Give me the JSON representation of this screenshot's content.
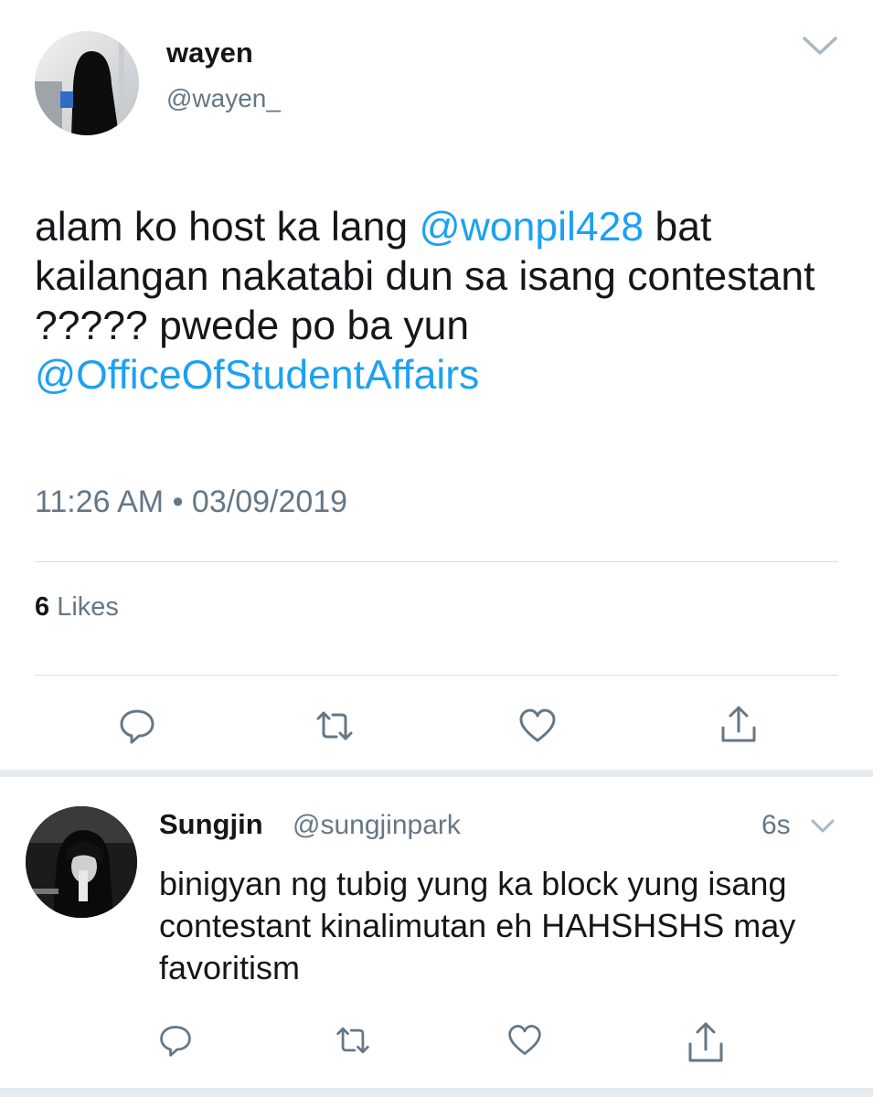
{
  "tweet": {
    "display_name": "wayen",
    "handle": "@wayen_",
    "text_1": "alam ko host ka lang ",
    "mention_1": "@wonpil428",
    "text_2": " bat kailangan nakatabi dun sa isang contestant ????? pwede po ba yun ",
    "mention_2": "@OfficeOfStudentAffairs",
    "timestamp": "11:26 AM • 03/09/2019",
    "likes_count": "6",
    "likes_label": " Likes",
    "actions": [
      "reply-icon",
      "retweet-icon",
      "like-icon",
      "share-icon"
    ]
  },
  "reply": {
    "display_name": "Sungjin",
    "handle": "@sungjinpark",
    "time": "6s",
    "text": "binigyan ng tubig yung ka block yung isang contestant kinalimutan eh HAHSHSHS may favoritism",
    "actions": [
      "reply-icon",
      "retweet-icon",
      "like-icon",
      "share-icon"
    ]
  },
  "colors": {
    "link": "#1da1f2",
    "secondary_text": "#657786",
    "icon": "#657786",
    "divider": "#d8dde2"
  }
}
